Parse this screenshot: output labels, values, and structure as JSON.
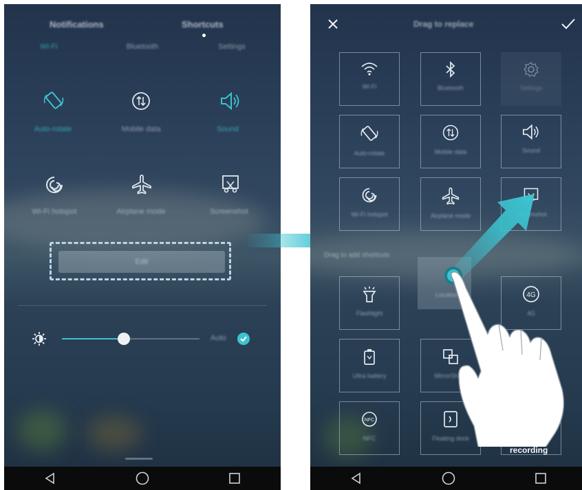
{
  "left": {
    "tabs": [
      "Notifications",
      "Shortcuts"
    ],
    "top_row": [
      "Wi-Fi",
      "Bluetooth",
      "Settings"
    ],
    "toggles": [
      {
        "label": "Auto-rotate",
        "icon": "auto-rotate-icon",
        "active": true
      },
      {
        "label": "Mobile data",
        "icon": "mobile-data-icon",
        "active": false
      },
      {
        "label": "Sound",
        "icon": "sound-icon",
        "active": true
      },
      {
        "label": "Wi-Fi hotspot",
        "icon": "hotspot-icon",
        "active": false
      },
      {
        "label": "Airplane mode",
        "icon": "airplane-icon",
        "active": false
      },
      {
        "label": "Screenshot",
        "icon": "screenshot-icon",
        "active": false
      }
    ],
    "edit_button": "Edit",
    "brightness": {
      "auto_label": "Auto",
      "level": 0.45
    }
  },
  "right": {
    "title": "Drag to replace",
    "close_icon": "close-icon",
    "confirm_icon": "check-icon",
    "tiles": [
      {
        "label": "Wi-Fi",
        "icon": "wifi-icon"
      },
      {
        "label": "Bluetooth",
        "icon": "bluetooth-icon"
      },
      {
        "label": "Settings",
        "icon": "settings-icon"
      },
      {
        "label": "Auto-rotate",
        "icon": "auto-rotate-icon"
      },
      {
        "label": "Mobile data",
        "icon": "mobile-data-icon"
      },
      {
        "label": "Sound",
        "icon": "sound-icon"
      },
      {
        "label": "Wi-Fi hotspot",
        "icon": "hotspot-icon"
      },
      {
        "label": "Airplane mode",
        "icon": "airplane-icon"
      },
      {
        "label": "Screenshot",
        "icon": "screenshot-icon"
      }
    ],
    "section_label": "Drag to add shortcuts",
    "lower_tiles": [
      {
        "label": "Flashlight",
        "icon": "flashlight-icon"
      },
      {
        "label": "Location",
        "icon": "location-icon"
      },
      {
        "label": "4G",
        "icon": "4g-icon"
      },
      {
        "label": "Ultra battery",
        "icon": "battery-icon"
      },
      {
        "label": "MirrorShare",
        "icon": "mirrorshare-icon"
      },
      {
        "label": "NFC",
        "icon": "nfc-icon"
      },
      {
        "label": "Floating dock",
        "icon": "floating-dock-icon"
      }
    ],
    "recording_label": "recording"
  },
  "nav": [
    "back-icon",
    "home-icon",
    "recents-icon"
  ],
  "colors": {
    "accent": "#3cc3d0",
    "arrow": "#3cc3d0",
    "dashed": "#bcd6e6"
  }
}
